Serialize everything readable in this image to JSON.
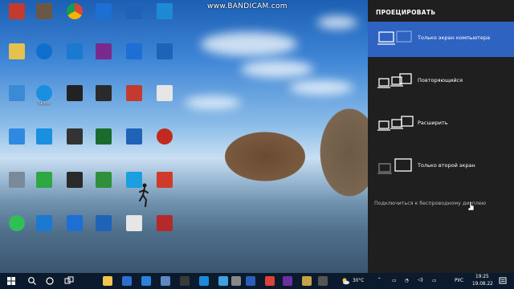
{
  "watermark": "www.BANDICAM.com",
  "desktop_icons": [
    {
      "name": "icon-r1c1",
      "caption": "",
      "color": "#c43a2e",
      "glyph": "folder"
    },
    {
      "name": "icon-r1c2",
      "caption": "",
      "color": "#6b5844",
      "glyph": "file"
    },
    {
      "name": "icon-r1c3",
      "caption": "",
      "color": "#ffffff",
      "glyph": "chrome"
    },
    {
      "name": "icon-r1c4",
      "caption": "",
      "color": "#1d6fd6",
      "glyph": "app"
    },
    {
      "name": "icon-r1c5",
      "caption": "",
      "color": "#1e63b8",
      "glyph": "app"
    },
    {
      "name": "icon-r1c6",
      "caption": "",
      "color": "#1e8ad6",
      "glyph": "app"
    },
    {
      "name": "icon-r2c1",
      "caption": "",
      "color": "#e5c24e",
      "glyph": "file"
    },
    {
      "name": "icon-r2c2",
      "caption": "",
      "color": "#0f6fcc",
      "glyph": "edge"
    },
    {
      "name": "icon-r2c3",
      "caption": "",
      "color": "#1b7ad0",
      "glyph": "app"
    },
    {
      "name": "icon-r2c4",
      "caption": "",
      "color": "#7a2a8c",
      "glyph": "app"
    },
    {
      "name": "icon-r2c5",
      "caption": "",
      "color": "#1d6fd6",
      "glyph": "app"
    },
    {
      "name": "icon-r2c6",
      "caption": "",
      "color": "#1e63b8",
      "glyph": "app"
    },
    {
      "name": "icon-r3c1",
      "caption": "",
      "color": "#3a8ad6",
      "glyph": "pc"
    },
    {
      "name": "icon-r3c2",
      "caption": "Skype",
      "color": "#1a8fe0",
      "glyph": "skype"
    },
    {
      "name": "icon-r3c3",
      "caption": "",
      "color": "#222222",
      "glyph": "game"
    },
    {
      "name": "icon-r3c4",
      "caption": "",
      "color": "#2a2a2a",
      "glyph": "game"
    },
    {
      "name": "icon-r3c5",
      "caption": "",
      "color": "#c43a2e",
      "glyph": "office"
    },
    {
      "name": "icon-r3c6",
      "caption": "",
      "color": "#e6e6e6",
      "glyph": "file"
    },
    {
      "name": "icon-r4c1",
      "caption": "",
      "color": "#2d8ae0",
      "glyph": "net"
    },
    {
      "name": "icon-r4c2",
      "caption": "",
      "color": "#1a8fe0",
      "glyph": "app"
    },
    {
      "name": "icon-r4c3",
      "caption": "",
      "color": "#333333",
      "glyph": "game"
    },
    {
      "name": "icon-r4c4",
      "caption": "",
      "color": "#1a6b2d",
      "glyph": "xbox"
    },
    {
      "name": "icon-r4c5",
      "caption": "",
      "color": "#1e63b8",
      "glyph": "app"
    },
    {
      "name": "icon-r4c6",
      "caption": "",
      "color": "#c32a1f",
      "glyph": "rec"
    },
    {
      "name": "icon-r5c1",
      "caption": "",
      "color": "#7a8a9a",
      "glyph": "trash"
    },
    {
      "name": "icon-r5c2",
      "caption": "",
      "color": "#2fa843",
      "glyph": "torrent"
    },
    {
      "name": "icon-r5c3",
      "caption": "",
      "color": "#2a2a2a",
      "glyph": "app"
    },
    {
      "name": "icon-r5c4",
      "caption": "",
      "color": "#2f8f3a",
      "glyph": "app"
    },
    {
      "name": "icon-r5c5",
      "caption": "",
      "color": "#1aa0e0",
      "glyph": "app"
    },
    {
      "name": "icon-r5c6",
      "caption": "",
      "color": "#d03a2a",
      "glyph": "pdf"
    },
    {
      "name": "icon-r6c1",
      "caption": "",
      "color": "#2fbf55",
      "glyph": "whatsapp"
    },
    {
      "name": "icon-r6c2",
      "caption": "",
      "color": "#1b7ad0",
      "glyph": "app"
    },
    {
      "name": "icon-r6c3",
      "caption": "",
      "color": "#1d6fd6",
      "glyph": "app"
    },
    {
      "name": "icon-r6c4",
      "caption": "",
      "color": "#1e63b8",
      "glyph": "app"
    },
    {
      "name": "icon-r6c5",
      "caption": "",
      "color": "#e6e6e6",
      "glyph": "file"
    },
    {
      "name": "icon-r6c6",
      "caption": "",
      "color": "#b42a2a",
      "glyph": "file"
    }
  ],
  "project_panel": {
    "title": "ПРОЕЦИРОВАТЬ",
    "options": [
      {
        "label": "Только экран компьютера",
        "active": true
      },
      {
        "label": "Повторяющийся",
        "active": false
      },
      {
        "label": "Расширить",
        "active": false
      },
      {
        "label": "Только второй экран",
        "active": false
      }
    ],
    "wireless_link": "Подключиться к беспроводному дисплею"
  },
  "taskbar": {
    "weather": "30°C",
    "language": "РУС",
    "time": "19:25",
    "date": "19.08.22"
  },
  "colors": {
    "panel_bg": "#1f1f1f",
    "active_option": "#2f63c2",
    "taskbar_bg": "#0b1a2c"
  }
}
